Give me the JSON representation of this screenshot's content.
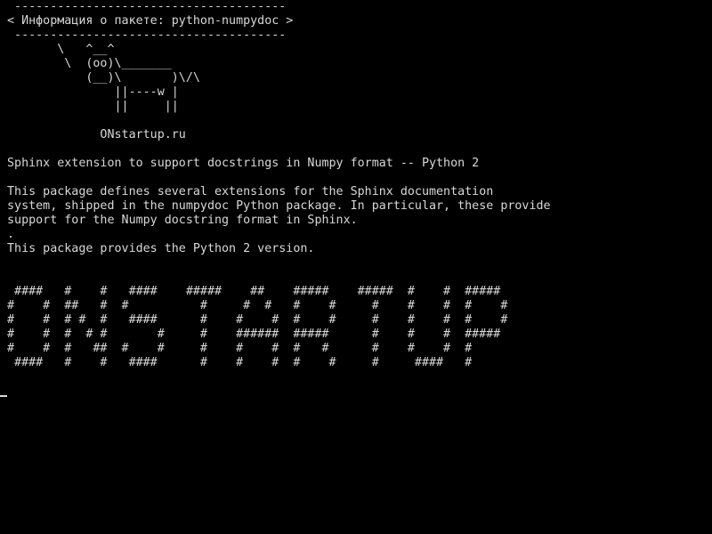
{
  "terminal": {
    "colors": {
      "background": "#000000",
      "foreground": "#d8d8d8"
    },
    "lines": [
      " --------------------------------------",
      "< Информация о пакете: python-numpydoc >",
      " --------------------------------------",
      "       \\   ^__^",
      "        \\  (oo)\\_______",
      "           (__)\\       )\\/\\",
      "               ||----w |",
      "               ||     ||",
      "",
      "             ONstartup.ru",
      "",
      "Sphinx extension to support docstrings in Numpy format -- Python 2",
      "",
      "This package defines several extensions for the Sphinx documentation",
      "system, shipped in the numpydoc Python package. In particular, these provide",
      "support for the Numpy docstring format in Sphinx.",
      ".",
      "This package provides the Python 2 version.",
      "",
      "",
      " ####   #    #   ####    #####    ##    #####    #####  #    #  #####",
      "#    #  ##   #  #          #     #  #   #    #     #    #    #  #    #",
      "#    #  # #  #   ####      #    #    #  #    #     #    #    #  #    #",
      "#    #  #  # #       #     #    ######  #####      #    #    #  #####",
      "#    #  #   ##  #    #     #    #    #  #   #      #    #    #  #",
      " ####   #    #   ####      #    #    #  #    #     #     ####   #"
    ],
    "cursor_char": "_"
  }
}
